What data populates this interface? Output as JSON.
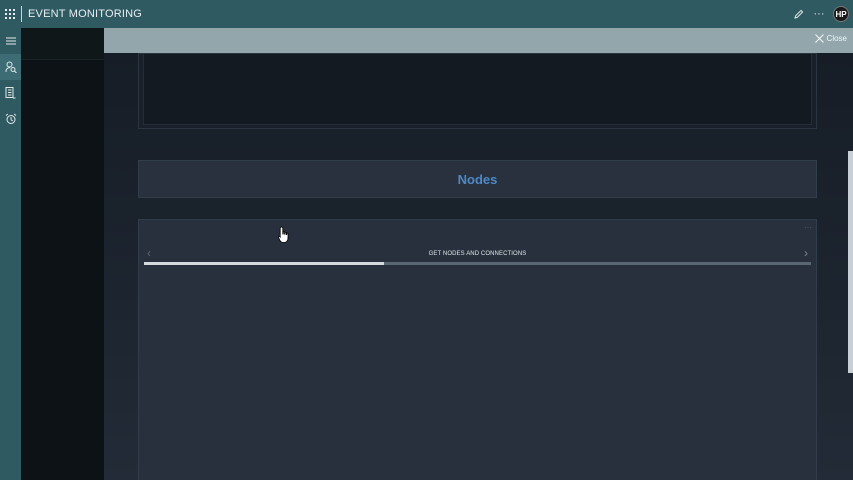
{
  "topbar": {
    "title": "EVENT MONITORING",
    "avatar_initials": "HP",
    "menu_icon": "waffle-icon",
    "edit_icon": "pencil-icon",
    "more_label": "···"
  },
  "rail": {
    "items": [
      {
        "icon": "hamburger-menu-icon",
        "active": false
      },
      {
        "icon": "person-search-icon",
        "active": true
      },
      {
        "icon": "report-list-icon",
        "active": false
      },
      {
        "icon": "alarm-clock-icon",
        "active": false
      }
    ]
  },
  "closebar": {
    "close_label": "Close"
  },
  "nodes_section": {
    "title": "Nodes"
  },
  "wizard": {
    "step_title": "GET NODES AND CONNECTIONS",
    "more_label": "···",
    "prev_glyph": "‹",
    "next_glyph": "›",
    "progress": 0.36
  },
  "scroll": {
    "position": 0.48,
    "visible_fraction": 0.52
  },
  "colors": {
    "topbar": "#2f5a62",
    "accent_title": "#4f88c6",
    "closebar": "#92a6ac"
  }
}
